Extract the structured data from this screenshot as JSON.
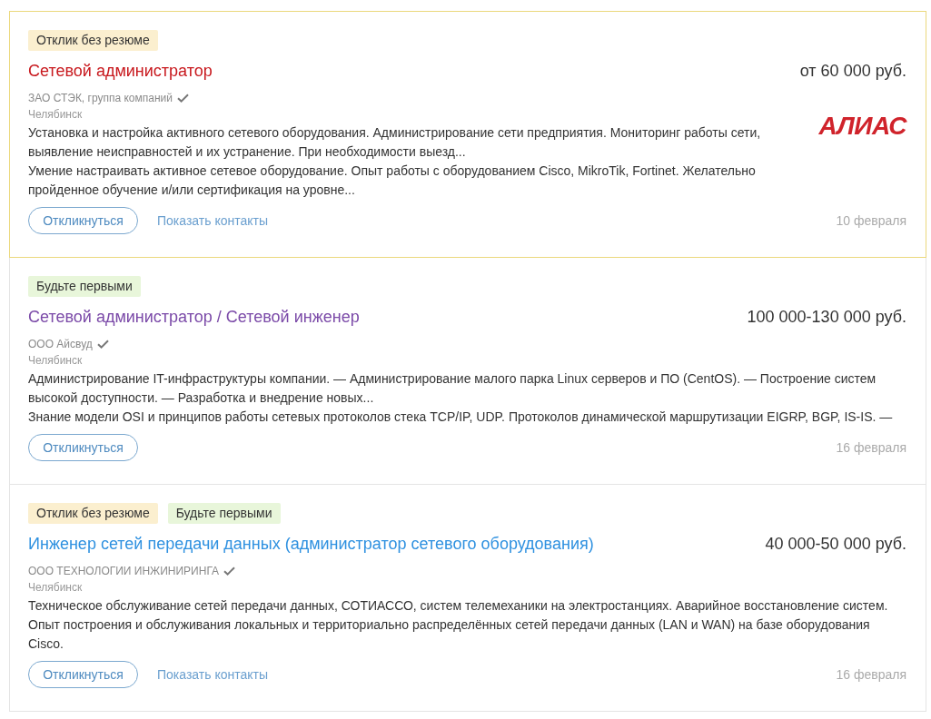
{
  "vacancies": [
    {
      "highlighted": true,
      "badges": [
        {
          "label": "Отклик без резюме",
          "kind": "no_resume"
        }
      ],
      "title": "Сетевой администратор",
      "color": "#c8191e",
      "salary": "от 60 000 руб.",
      "company": "ЗАО СТЭК, группа компаний",
      "verified": true,
      "city": "Челябинск",
      "logo": "АЛИАС",
      "description": [
        "Установка и настройка активного сетевого оборудования. Администрирование сети предприятия. Мониторинг работы сети, выявление неисправностей и их устранение. При необходимости выезд...",
        "Умение настраивать активное сетевое оборудование. Опыт работы с оборудованием Cisco, MikroTik, Fortinet. Желательно пройденное обучение и/или сертификация на уровне..."
      ],
      "apply_button": "Откликнуться",
      "contacts_link": "Показать контакты",
      "date": "10 февраля"
    },
    {
      "highlighted": false,
      "badges": [
        {
          "label": "Будьте первыми",
          "kind": "be_first"
        }
      ],
      "title": "Сетевой администратор / Сетевой инженер",
      "color": "#7b4aa8",
      "salary": "100 000-130 000 руб.",
      "company": "ООО Айсвуд",
      "verified": true,
      "city": "Челябинск",
      "description": [
        "Администрирование IT-инфраструктуры компании. — Администрирование малого парка Linux серверов и ПО (CentOS). — Построение систем высокой доступности. — Разработка и внедрение новых...",
        "Знание модели OSI и принципов работы сетевых протоколов стека TCP/IP, UDP. Протоколов динамической маршрутизации EIGRP, BGP, IS-IS. —"
      ],
      "apply_button": "Откликнуться",
      "date": "16 февраля"
    },
    {
      "highlighted": false,
      "badges": [
        {
          "label": "Отклик без резюме",
          "kind": "no_resume"
        },
        {
          "label": "Будьте первыми",
          "kind": "be_first"
        }
      ],
      "title": "Инженер сетей передачи данных (администратор сетевого оборудования)",
      "color": "#2f91e0",
      "salary": "40 000-50 000 руб.",
      "company": "ООО ТЕХНОЛОГИИ ИНЖИНИРИНГА",
      "verified": true,
      "city": "Челябинск",
      "description": [
        "Техническое обслуживание сетей передачи данных, СОТИАССО, систем телемеханики на электростанциях. Аварийное восстановление систем.",
        "Опыт построения и обслуживания локальных и территориально распределённых сетей передачи данных (LAN и WAN) на базе оборудования Cisco."
      ],
      "apply_button": "Откликнуться",
      "contacts_link": "Показать контакты",
      "date": "16 февраля"
    }
  ]
}
